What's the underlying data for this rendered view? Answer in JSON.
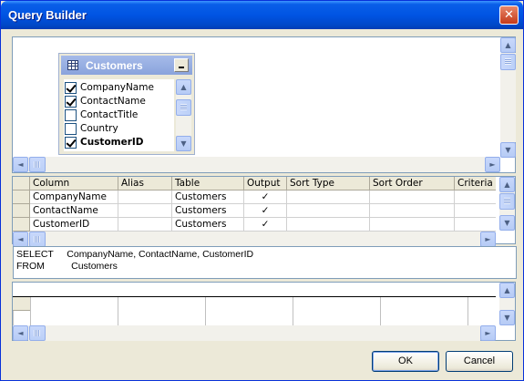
{
  "window": {
    "title": "Query Builder",
    "close_glyph": "✕"
  },
  "table_window": {
    "title": "Customers",
    "fields": [
      {
        "label": "CompanyName",
        "checked": true,
        "bold": false
      },
      {
        "label": "ContactName",
        "checked": true,
        "bold": false
      },
      {
        "label": "ContactTitle",
        "checked": false,
        "bold": false
      },
      {
        "label": "Country",
        "checked": false,
        "bold": false
      },
      {
        "label": "CustomerID",
        "checked": true,
        "bold": true
      }
    ]
  },
  "grid": {
    "headers": [
      "Column",
      "Alias",
      "Table",
      "Output",
      "Sort Type",
      "Sort Order",
      "Criteria"
    ],
    "rows": [
      {
        "column": "CompanyName",
        "alias": "",
        "table": "Customers",
        "output": "✓"
      },
      {
        "column": "ContactName",
        "alias": "",
        "table": "Customers",
        "output": "✓"
      },
      {
        "column": "CustomerID",
        "alias": "",
        "table": "Customers",
        "output": "✓"
      }
    ]
  },
  "sql": {
    "select_keyword": "SELECT",
    "select_columns": "CompanyName, ContactName, CustomerID",
    "from_keyword": "FROM",
    "from_table": "Customers"
  },
  "buttons": {
    "ok": "OK",
    "cancel": "Cancel"
  },
  "icons": {
    "up": "▲",
    "down": "▼",
    "left": "◄",
    "right": "►",
    "table": "table-icon"
  }
}
